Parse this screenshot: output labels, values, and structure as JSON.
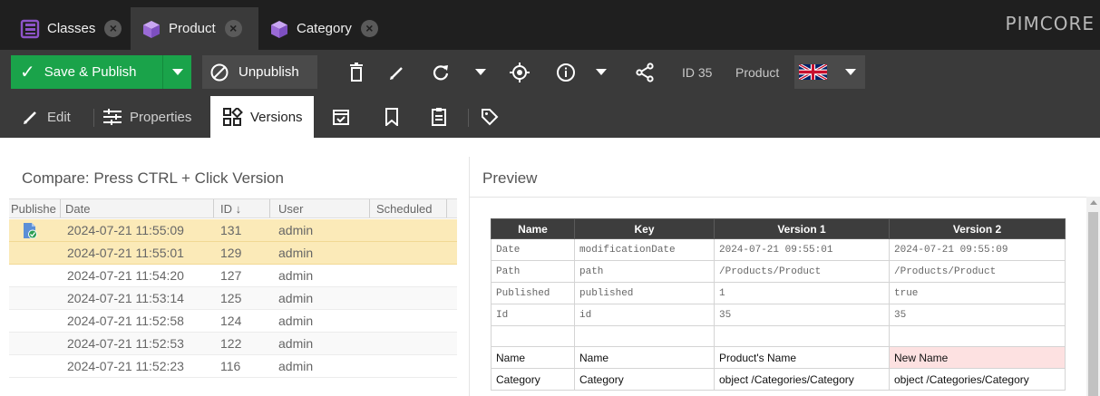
{
  "tabs": [
    {
      "label": "Classes",
      "icon": "classes-icon",
      "color": "#8e54c9"
    },
    {
      "label": "Product",
      "icon": "cube-icon",
      "color": "#9a6ad6",
      "active": true
    },
    {
      "label": "Category",
      "icon": "cube-icon",
      "color": "#9a6ad6"
    }
  ],
  "brand": "PIMCORE",
  "toolbar": {
    "save_publish": "Save & Publish",
    "unpublish": "Unpublish",
    "id_text": "ID 35",
    "class_text": "Product",
    "language_flag": "uk-flag-icon",
    "accent": "#1aa34a"
  },
  "subtabs": [
    {
      "label": "Edit"
    },
    {
      "label": "Properties"
    },
    {
      "label": "Versions",
      "active": true
    }
  ],
  "left": {
    "title": "Compare: Press CTRL + Click Version",
    "columns": [
      "Publishe",
      "Date",
      "ID",
      "User",
      "Scheduled"
    ],
    "sort_indicator": "↓",
    "rows": [
      {
        "published": true,
        "date": "2024-07-21 11:55:09",
        "id": "131",
        "user": "admin",
        "selected": true
      },
      {
        "published": false,
        "date": "2024-07-21 11:55:01",
        "id": "129",
        "user": "admin",
        "selected": true
      },
      {
        "published": false,
        "date": "2024-07-21 11:54:20",
        "id": "127",
        "user": "admin"
      },
      {
        "published": false,
        "date": "2024-07-21 11:53:14",
        "id": "125",
        "user": "admin"
      },
      {
        "published": false,
        "date": "2024-07-21 11:52:58",
        "id": "124",
        "user": "admin"
      },
      {
        "published": false,
        "date": "2024-07-21 11:52:53",
        "id": "122",
        "user": "admin"
      },
      {
        "published": false,
        "date": "2024-07-21 11:52:23",
        "id": "116",
        "user": "admin"
      }
    ]
  },
  "right": {
    "title": "Preview",
    "headers": [
      "Name",
      "Key",
      "Version 1",
      "Version 2"
    ],
    "system_rows": [
      [
        "Date",
        "modificationDate",
        "2024-07-21 09:55:01",
        "2024-07-21 09:55:09"
      ],
      [
        "Path",
        "path",
        "/Products/Product",
        "/Products/Product"
      ],
      [
        "Published",
        "published",
        "1",
        "true"
      ],
      [
        "Id",
        "id",
        "35",
        "35"
      ]
    ],
    "field_rows": [
      {
        "cells": [
          "Name",
          "Name",
          "Product's Name",
          "New Name"
        ],
        "diff": true
      },
      {
        "cells": [
          "Category",
          "Category",
          "object /Categories/Category",
          "object /Categories/Category"
        ],
        "diff": false
      }
    ],
    "diff_color": "#fde1e1"
  }
}
